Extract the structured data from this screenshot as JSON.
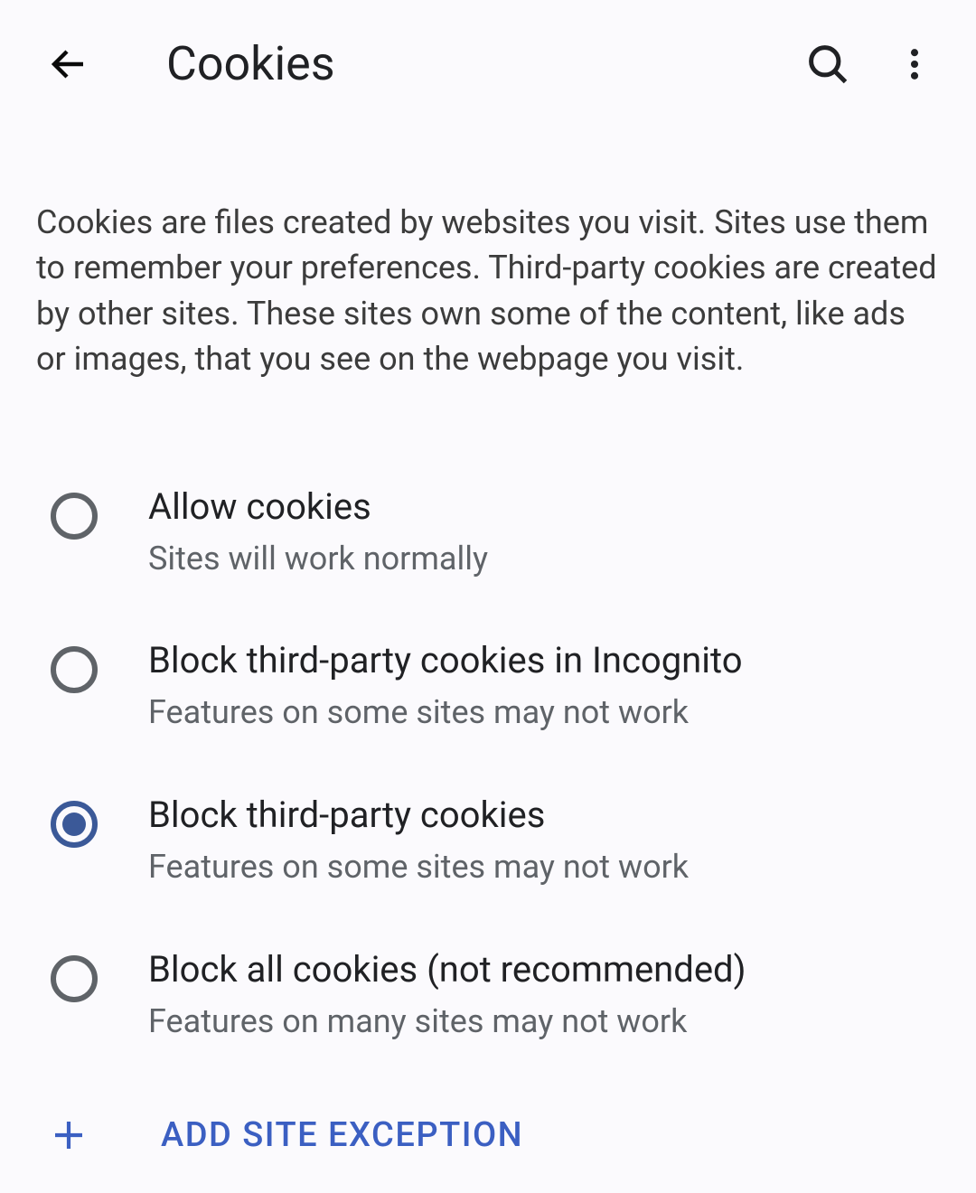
{
  "header": {
    "title": "Cookies"
  },
  "description": "Cookies are files created by websites you visit. Sites use them to remember your preferences. Third-party cookies are created by other sites. These sites own some of the content, like ads or images, that you see on the webpage you visit.",
  "options": [
    {
      "title": "Allow cookies",
      "subtitle": "Sites will work normally",
      "selected": false
    },
    {
      "title": "Block third-party cookies in Incognito",
      "subtitle": "Features on some sites may not work",
      "selected": false
    },
    {
      "title": "Block third-party cookies",
      "subtitle": "Features on some sites may not work",
      "selected": true
    },
    {
      "title": "Block all cookies (not recommended)",
      "subtitle": "Features on many sites may not work",
      "selected": false
    }
  ],
  "addException": {
    "label": "ADD SITE EXCEPTION"
  }
}
